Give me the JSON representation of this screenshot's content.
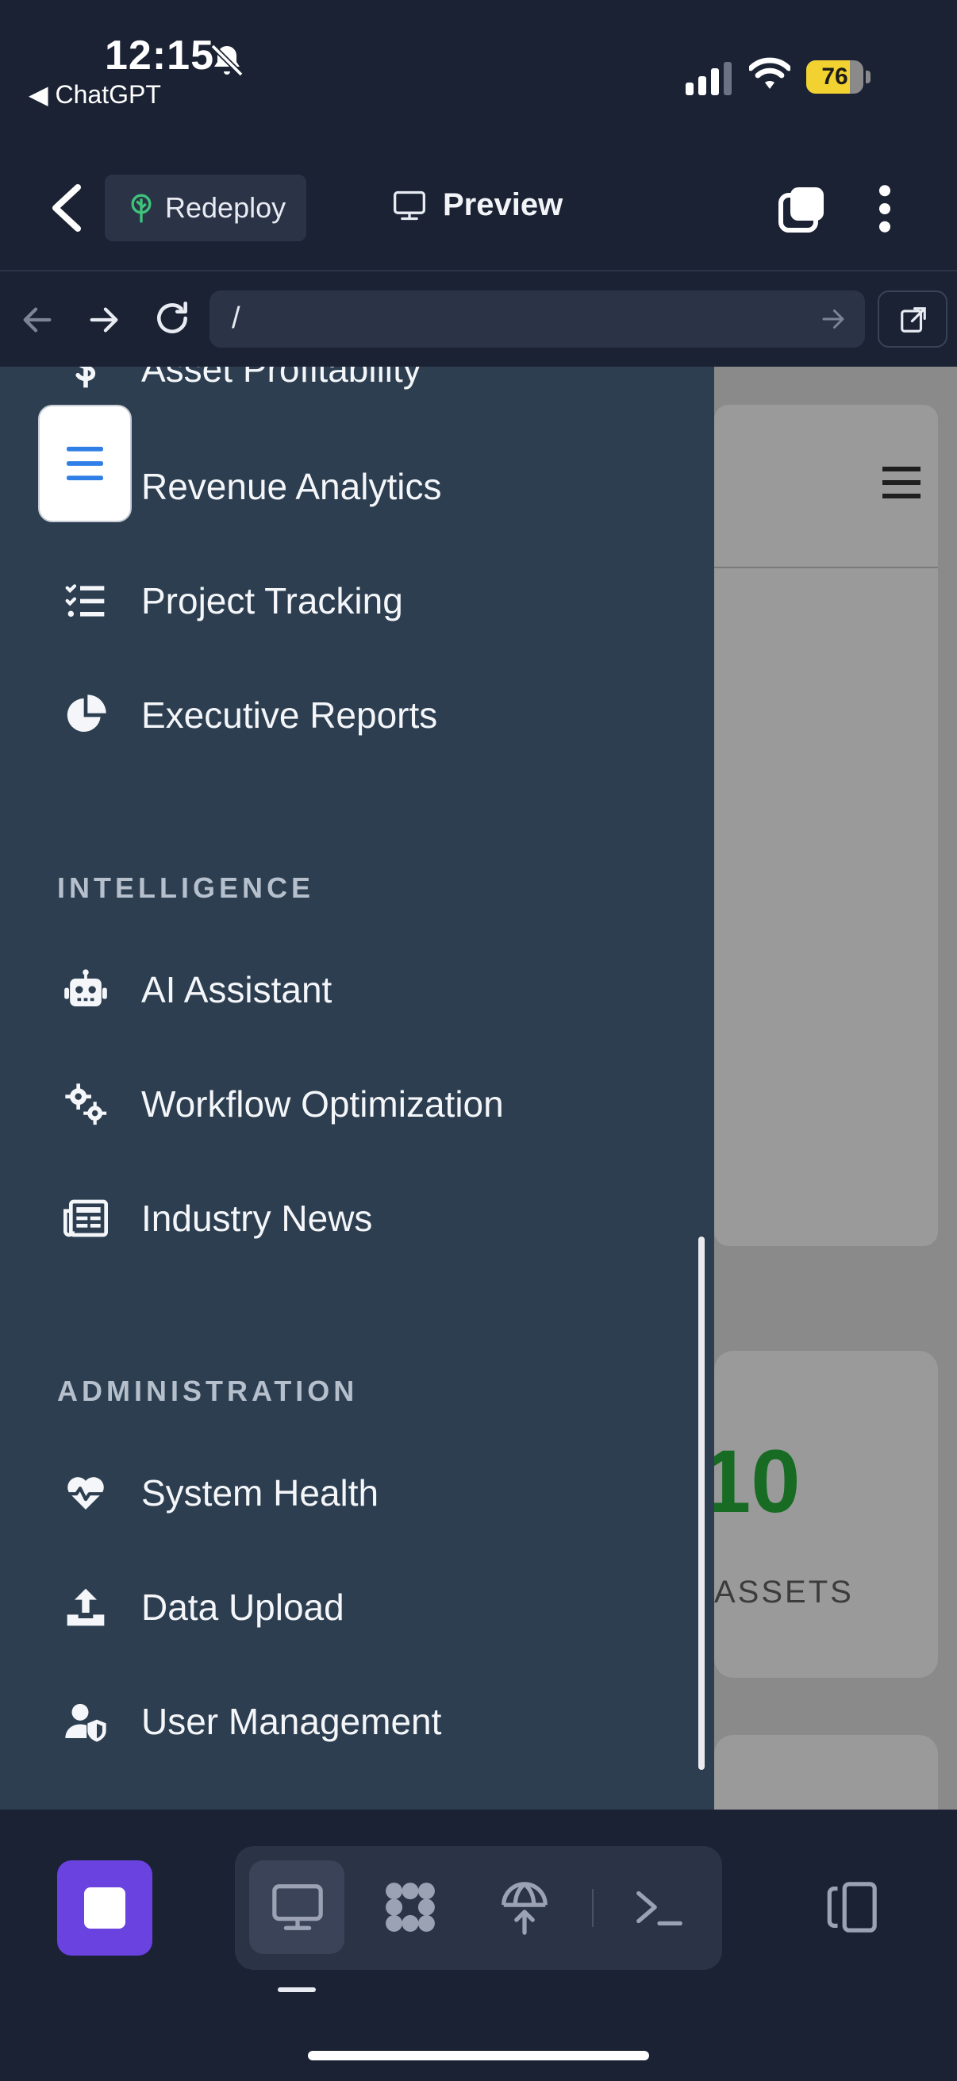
{
  "status_bar": {
    "time": "12:15",
    "back_app": "◀ ChatGPT",
    "battery": "76",
    "battery_fraction": 0.76
  },
  "toolbar": {
    "redeploy_label": "Redeploy",
    "preview_label": "Preview"
  },
  "url_bar": {
    "value": "/"
  },
  "sidebar": {
    "items_top": [
      {
        "label": "Asset Profitability",
        "icon": "dollar-icon"
      },
      {
        "label": "Revenue Analytics",
        "icon": "chart-icon"
      },
      {
        "label": "Project Tracking",
        "icon": "tasks-icon"
      },
      {
        "label": "Executive Reports",
        "icon": "pie-chart-icon"
      }
    ],
    "intelligence_title": "INTELLIGENCE",
    "intelligence_items": [
      {
        "label": "AI Assistant",
        "icon": "robot-icon"
      },
      {
        "label": "Workflow Optimization",
        "icon": "cogs-icon"
      },
      {
        "label": "Industry News",
        "icon": "newspaper-icon"
      }
    ],
    "administration_title": "ADMINISTRATION",
    "administration_items": [
      {
        "label": "System Health",
        "icon": "heartbeat-icon"
      },
      {
        "label": "Data Upload",
        "icon": "upload-icon"
      },
      {
        "label": "User Management",
        "icon": "user-shield-icon"
      }
    ]
  },
  "background_page": {
    "metric_value": "10",
    "metric_label": "ASSETS"
  },
  "colors": {
    "sidebar_bg": "#2c3e50",
    "app_bg": "#1b2234",
    "accent_purple": "#6a42e0",
    "metric_green": "#176b23"
  }
}
